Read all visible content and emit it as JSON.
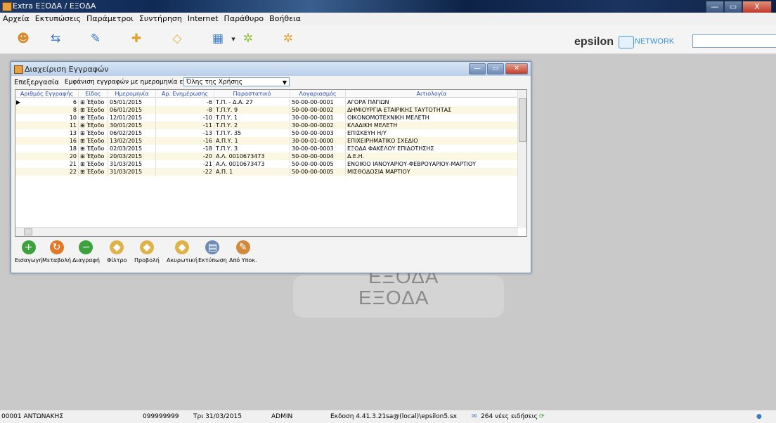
{
  "window": {
    "title": "Extra ΕΞΟΔΑ / ΕΞΟΔΑ",
    "min": "—",
    "max": "▭",
    "close": "X"
  },
  "menu": [
    "Αρχεία",
    "Εκτυπώσεις",
    "Παράμετροι",
    "Συντήρηση",
    "Internet",
    "Παράθυρο",
    "Βοήθεια"
  ],
  "toolbar_icons": [
    "users-icon",
    "share-icon",
    "edit-icon",
    "tools-icon",
    "folder-icon",
    "calculator-icon",
    "dropdown-icon",
    "gears-icon",
    "gear-icon"
  ],
  "brand": {
    "name": "epsilon",
    "network": "NETWORK"
  },
  "background_watermark": [
    "ΕΞΟΔΑ",
    "ΕΞΟΔΑ"
  ],
  "dialog": {
    "title": "Διαχείριση Εγγραφών",
    "menu_edit": "Επεξεργασία",
    "menu_show": "Εμφάνιση εγγραφών με ημερομηνία εντός",
    "period": "Όλης της Χρήσης",
    "columns": [
      "Αριθμός Εγγραφής",
      "Είδος",
      "Ημερομηνία",
      "Αρ. Ενημέρωσης",
      "Παραστατικό",
      "Λογαριασμός",
      "Αιτιολογία"
    ],
    "rows": [
      [
        "6",
        "⊞ Έξοδο",
        "05/01/2015",
        "-6",
        "Τ.Π. - Δ.Α. 27",
        "50-00-00-0001",
        "ΑΓΟΡΑ ΠΑΓΙΩΝ"
      ],
      [
        "8",
        "⊞ Έξοδο",
        "06/01/2015",
        "-8",
        "Τ.Π.Υ. 9",
        "50-00-00-0002",
        "ΔΗΜΙΟΥΡΓΙΑ ΕΤΑΙΡΙΚΗΣ ΤΑΥΤΟΤΗΤΑΣ"
      ],
      [
        "10",
        "⊞ Έξοδο",
        "12/01/2015",
        "-10",
        "Τ.Π.Υ. 1",
        "30-00-00-0001",
        "ΟΙΚΟΝΟΜΟΤΕΧΝΙΚΗ ΜΕΛΕΤΗ"
      ],
      [
        "11",
        "⊞ Έξοδο",
        "30/01/2015",
        "-11",
        "Τ.Π.Υ. 2",
        "30-00-00-0002",
        "ΚΛΑΔΙΚΗ ΜΕΛΕΤΗ"
      ],
      [
        "13",
        "⊞ Έξοδο",
        "06/02/2015",
        "-13",
        "Τ.Π.Υ. 35",
        "50-00-00-0003",
        "ΕΠΙΣΚΕΥΗ Η/Υ"
      ],
      [
        "16",
        "⊞ Έξοδο",
        "13/02/2015",
        "-16",
        "Α.Π.Υ. 1",
        "30-00-01-0000",
        "ΕΠΙΧΕΙΡΗΜΑΤΙΚΟ ΣΧΕΔΙΟ"
      ],
      [
        "18",
        "⊞ Έξοδο",
        "02/03/2015",
        "-18",
        "Τ.Π.Υ. 3",
        "30-00-00-0003",
        "ΕΞΟΔΑ ΦΑΚΕΛΟΥ ΕΠΙΔΟΤΗΣΗΣ"
      ],
      [
        "20",
        "⊞ Έξοδο",
        "20/03/2015",
        "-20",
        "Α.Λ. 0010673473",
        "50-00-00-0004",
        "Δ.Ε.Η."
      ],
      [
        "21",
        "⊞ Έξοδο",
        "31/03/2015",
        "-21",
        "Α.Λ. 0010673473",
        "50-00-00-0005",
        "ΕΝΟΙΚΙΟ ΙΑΝΟΥΑΡΙΟΥ-ΦΕΒΡΟΥΑΡΙΟΥ-ΜΑΡΤΙΟΥ"
      ],
      [
        "22",
        "⊞ Έξοδο",
        "31/03/2015",
        "-22",
        "Α.Π. 1",
        "50-00-00-0005",
        "ΜΙΣΘΟΔΟΣΙΑ ΜΑΡΤΙΟΥ"
      ]
    ],
    "tools": [
      {
        "label": "Εισαγωγή",
        "icon": "add-icon",
        "color": "#3ca33c",
        "glyph": "+"
      },
      {
        "label": "Μεταβολή",
        "icon": "modify-icon",
        "color": "#e07a2a",
        "glyph": "↻"
      },
      {
        "label": "Διαγραφή",
        "icon": "delete-icon",
        "color": "#3ca33c",
        "glyph": "−"
      },
      {
        "label": "Φίλτρο",
        "icon": "filter-icon",
        "color": "#e0b24a",
        "glyph": "◆"
      },
      {
        "label": "Προβολή",
        "icon": "view-icon",
        "color": "#e0b24a",
        "glyph": "◆"
      },
      {
        "label": "Ακυρωτική",
        "icon": "cancel-icon",
        "color": "#e0b24a",
        "glyph": "◆"
      },
      {
        "label": "Εκτύπωση",
        "icon": "print-icon",
        "color": "#6a8ab8",
        "glyph": "▤"
      },
      {
        "label": "Από Υποκ.",
        "icon": "branch-icon",
        "color": "#d08a3a",
        "glyph": "✎"
      }
    ]
  },
  "status": {
    "user": "00001 ΑΝΤΩΝΑΚΗΣ",
    "code": "099999999",
    "date": "Τρι 31/03/2015",
    "role": "ADMIN",
    "version": "Εκδοση 4.41.3.21",
    "connection": "sa@(local)\\epsilon5.sx",
    "news": "264 νέες ειδήσεις"
  }
}
